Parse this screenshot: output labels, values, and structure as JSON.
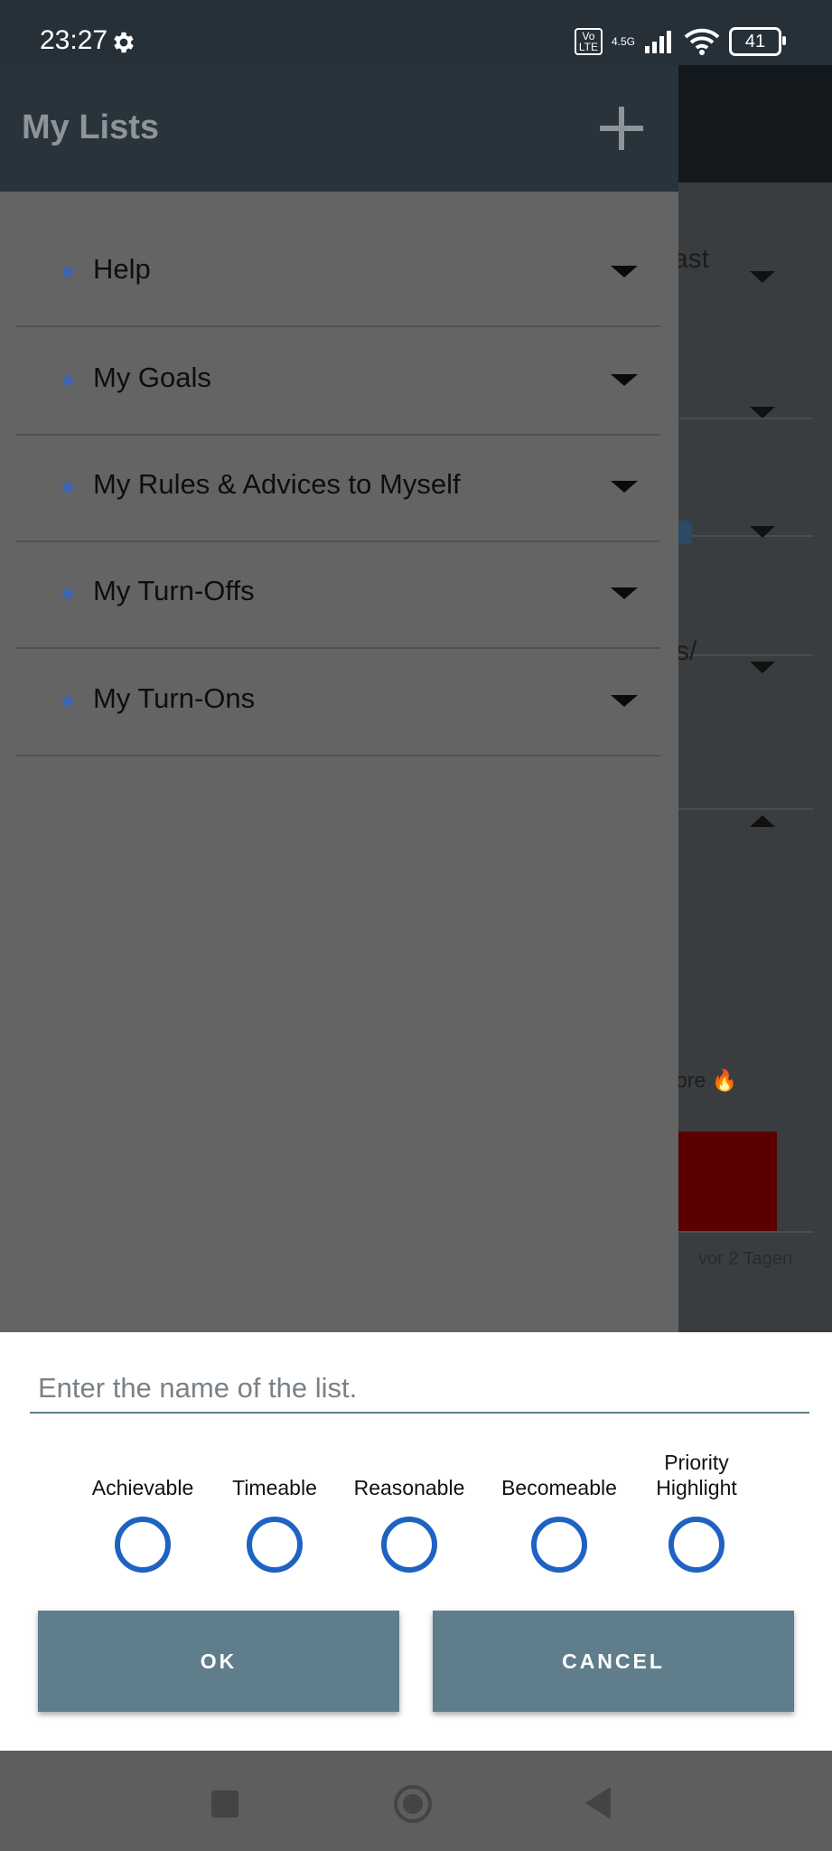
{
  "status_bar": {
    "time": "23:27",
    "volte": "Vo\nLTE",
    "network": "4.5G",
    "battery": "41",
    "icons": [
      "gear-icon",
      "signal-icon",
      "wifi-icon",
      "battery-icon"
    ]
  },
  "drawer": {
    "title": "My Lists",
    "add_icon": "plus-icon",
    "items": [
      {
        "label": "Help"
      },
      {
        "label": "My Goals"
      },
      {
        "label": "My Rules & Advices to Myself"
      },
      {
        "label": "My Turn-Offs"
      },
      {
        "label": "My Turn-Ons"
      }
    ]
  },
  "background": {
    "fragments": [
      "ast",
      "s/",
      "ore 🔥",
      "vor 2 Tagen"
    ]
  },
  "dialog": {
    "input_placeholder": "Enter the name of the list.",
    "options": [
      {
        "label": "Achievable",
        "checked": false
      },
      {
        "label": "Timeable",
        "checked": false
      },
      {
        "label": "Reasonable",
        "checked": false
      },
      {
        "label": "Becomeable",
        "checked": false
      },
      {
        "label": "Priority\nHighlight",
        "checked": false
      }
    ],
    "ok_label": "OK",
    "cancel_label": "CANCEL"
  },
  "colors": {
    "header": "#29333b",
    "accent_radio": "#1e62c2",
    "button": "#607d8b"
  }
}
